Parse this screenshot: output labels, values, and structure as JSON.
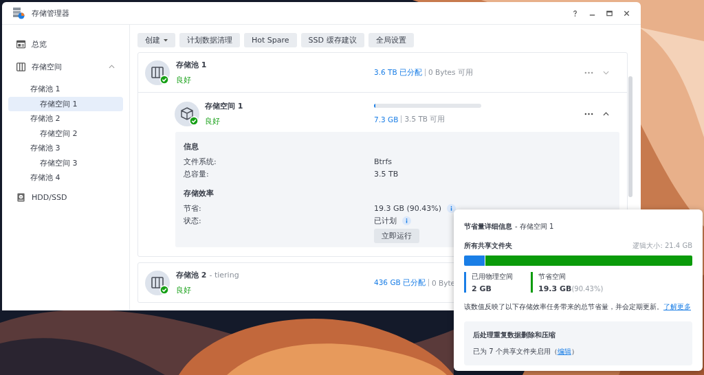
{
  "window": {
    "title": "存储管理器"
  },
  "sidebar": {
    "items": [
      {
        "label": "总览",
        "selected": false
      },
      {
        "label": "存储空间",
        "expanded": true,
        "selected": false,
        "children": [
          {
            "label": "存储池 1",
            "selected": false,
            "children": [
              {
                "label": "存储空间 1",
                "selected": true
              }
            ]
          },
          {
            "label": "存储池 2",
            "selected": false,
            "children": [
              {
                "label": "存储空间 2",
                "selected": false
              }
            ]
          },
          {
            "label": "存储池 3",
            "selected": false,
            "children": [
              {
                "label": "存储空间 3",
                "selected": false
              }
            ]
          },
          {
            "label": "存储池 4",
            "selected": false
          }
        ]
      },
      {
        "label": "HDD/SSD",
        "selected": false
      }
    ]
  },
  "toolbar": [
    {
      "label": "创建",
      "has_menu": true
    },
    {
      "label": "计划数据清理",
      "has_menu": false
    },
    {
      "label": "Hot Spare",
      "has_menu": false
    },
    {
      "label": "SSD 缓存建议",
      "has_menu": false
    },
    {
      "label": "全局设置",
      "has_menu": false
    }
  ],
  "pools": [
    {
      "name": "存储池 1",
      "status": "良好",
      "healthy": true,
      "allocated": "3.6 TB 已分配",
      "available": "0 Bytes 可用",
      "expanded": false,
      "volume": {
        "name": "存储空间 1",
        "status": "良好",
        "healthy": true,
        "level": 0.01,
        "used": "7.3 GB",
        "available": "3.5 TB 可用",
        "expanded": true,
        "sections": [
          {
            "title": "信息",
            "rows": [
              {
                "label": "文件系统:",
                "value": "Btrfs",
                "info": false
              },
              {
                "label": "总容量:",
                "value": "3.5 TB",
                "info": false
              }
            ]
          },
          {
            "title": "存储效率",
            "rows": [
              {
                "label": "节省:",
                "value": "19.3 GB (90.43%)",
                "info": true
              },
              {
                "label": "状态:",
                "value": "已计划",
                "info": true
              }
            ]
          }
        ],
        "action": "立即运行"
      }
    },
    {
      "name": "存储池 2",
      "suffix": "- tiering",
      "status": "良好",
      "healthy": true,
      "allocated": "436 GB 已分配",
      "available": "0 Byte"
    }
  ],
  "popup": {
    "title": "节省量详细信息",
    "subtitle": "- 存储空间 1",
    "section": "所有共享文件夹",
    "logical_size": "逻辑大小: 21.4 GB",
    "level": 0.09,
    "legend": [
      {
        "label": "已用物理空间",
        "value": "2 GB",
        "color": "#1a7ee6"
      },
      {
        "label": "节省空间",
        "value": "19.3 GB",
        "percent": "(90.43%)",
        "color": "#0a9b0a"
      }
    ],
    "note": "该数值反映了以下存储效率任务带来的总节省量，并会定期更新。",
    "note_link": "了解更多",
    "box": {
      "title": "后处理重复数据删除和压缩",
      "text_before": "已为 7 个共享文件夹启用（",
      "link": "编辑",
      "text_after": "）"
    }
  }
}
